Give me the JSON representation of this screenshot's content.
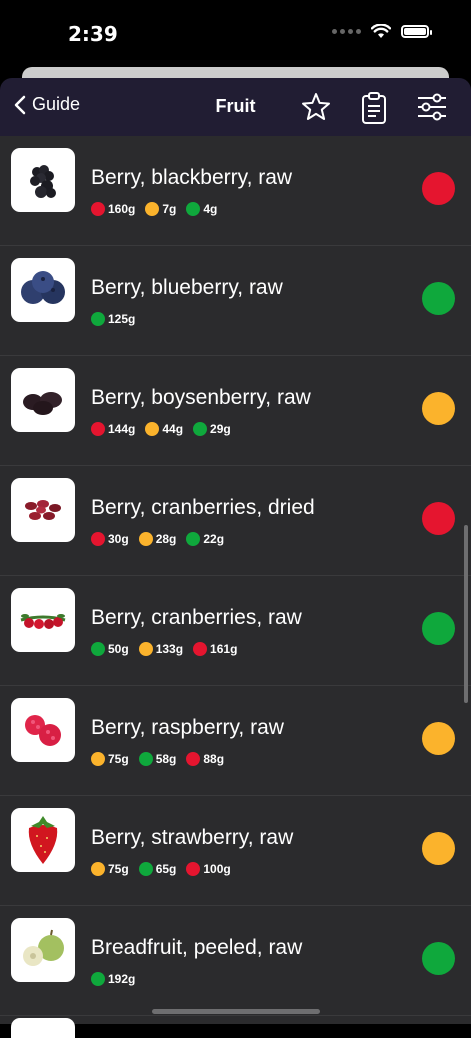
{
  "status_bar": {
    "time": "2:39"
  },
  "nav": {
    "back_label": "Guide",
    "title": "Fruit",
    "icons": [
      "star-icon",
      "clipboard-icon",
      "sliders-icon"
    ]
  },
  "colors": {
    "red": "#e5152f",
    "amber": "#fbb32c",
    "green": "#0fa83c",
    "nav_bg": "#211d33",
    "list_bg": "#2b2b2d"
  },
  "items": [
    {
      "name": "Berry, blackberry, raw",
      "status": "red",
      "image": "blackberry",
      "tags": [
        {
          "color": "red",
          "amount": "160g"
        },
        {
          "color": "amber",
          "amount": "7g"
        },
        {
          "color": "green",
          "amount": "4g"
        }
      ]
    },
    {
      "name": "Berry, blueberry, raw",
      "status": "green",
      "image": "blueberry",
      "tags": [
        {
          "color": "green",
          "amount": "125g"
        }
      ]
    },
    {
      "name": "Berry, boysenberry, raw",
      "status": "amber",
      "image": "boysenberry",
      "tags": [
        {
          "color": "red",
          "amount": "144g"
        },
        {
          "color": "amber",
          "amount": "44g"
        },
        {
          "color": "green",
          "amount": "29g"
        }
      ]
    },
    {
      "name": "Berry, cranberries, dried",
      "status": "red",
      "image": "dried-cranberries",
      "tags": [
        {
          "color": "red",
          "amount": "30g"
        },
        {
          "color": "amber",
          "amount": "28g"
        },
        {
          "color": "green",
          "amount": "22g"
        }
      ]
    },
    {
      "name": "Berry, cranberries, raw",
      "status": "green",
      "image": "cranberries",
      "tags": [
        {
          "color": "green",
          "amount": "50g"
        },
        {
          "color": "amber",
          "amount": "133g"
        },
        {
          "color": "red",
          "amount": "161g"
        }
      ]
    },
    {
      "name": "Berry, raspberry, raw",
      "status": "amber",
      "image": "raspberry",
      "tags": [
        {
          "color": "amber",
          "amount": "75g"
        },
        {
          "color": "green",
          "amount": "58g"
        },
        {
          "color": "red",
          "amount": "88g"
        }
      ]
    },
    {
      "name": "Berry, strawberry, raw",
      "status": "amber",
      "image": "strawberry",
      "tags": [
        {
          "color": "amber",
          "amount": "75g"
        },
        {
          "color": "green",
          "amount": "65g"
        },
        {
          "color": "red",
          "amount": "100g"
        }
      ]
    },
    {
      "name": "Breadfruit, peeled, raw",
      "status": "green",
      "image": "breadfruit",
      "tags": [
        {
          "color": "green",
          "amount": "192g"
        }
      ]
    }
  ]
}
